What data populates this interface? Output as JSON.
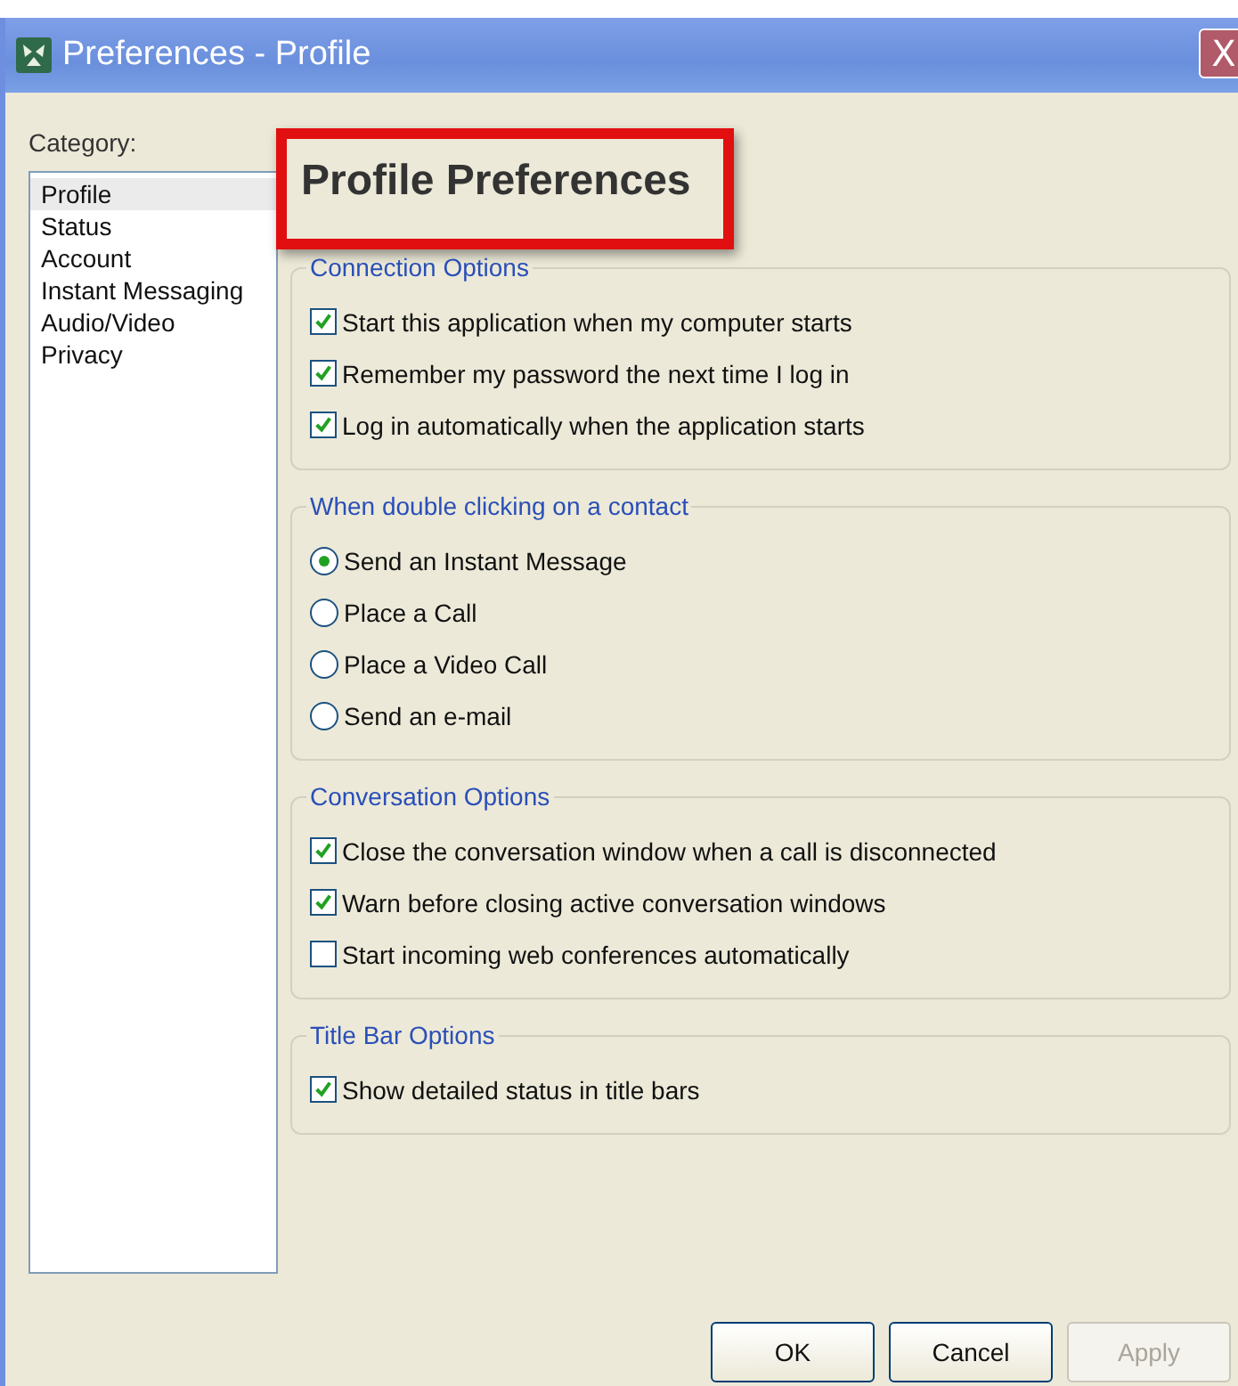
{
  "window": {
    "title": "Preferences - Profile",
    "close": "X"
  },
  "category": {
    "label": "Category:",
    "items": [
      {
        "label": "Profile",
        "selected": true
      },
      {
        "label": "Status",
        "selected": false
      },
      {
        "label": "Account",
        "selected": false
      },
      {
        "label": "Instant Messaging",
        "selected": false
      },
      {
        "label": "Audio/Video",
        "selected": false
      },
      {
        "label": "Privacy",
        "selected": false
      }
    ]
  },
  "heading": "Profile Preferences",
  "groups": [
    {
      "title": "Connection Options",
      "kind": "checkbox",
      "options": [
        {
          "label": "Start this application when my computer starts",
          "checked": true
        },
        {
          "label": "Remember my password the next time I log in",
          "checked": true
        },
        {
          "label": "Log in automatically when the application starts",
          "checked": true
        }
      ]
    },
    {
      "title": "When double clicking on a contact",
      "kind": "radio",
      "options": [
        {
          "label": "Send an Instant Message",
          "selected": true
        },
        {
          "label": "Place a Call",
          "selected": false
        },
        {
          "label": "Place a Video Call",
          "selected": false
        },
        {
          "label": "Send an e-mail",
          "selected": false
        }
      ]
    },
    {
      "title": "Conversation Options",
      "kind": "checkbox",
      "options": [
        {
          "label": "Close the conversation window when a call is disconnected",
          "checked": true
        },
        {
          "label": "Warn before closing active conversation windows",
          "checked": true
        },
        {
          "label": "Start incoming web conferences automatically",
          "checked": false
        }
      ]
    },
    {
      "title": "Title Bar Options",
      "kind": "checkbox",
      "options": [
        {
          "label": "Show detailed status in title bars",
          "checked": true
        }
      ]
    }
  ],
  "buttons": [
    {
      "label": "OK",
      "disabled": false
    },
    {
      "label": "Cancel",
      "disabled": false
    },
    {
      "label": "Apply",
      "disabled": true
    }
  ]
}
